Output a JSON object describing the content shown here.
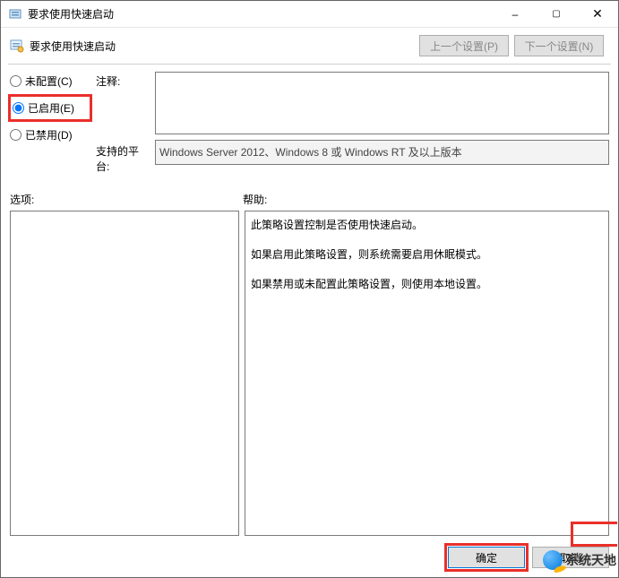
{
  "window": {
    "title": "要求使用快速启动"
  },
  "header": {
    "policy_title": "要求使用快速启动",
    "prev_label": "上一个设置(P)",
    "next_label": "下一个设置(N)"
  },
  "radios": {
    "not_configured": "未配置(C)",
    "enabled": "已启用(E)",
    "disabled": "已禁用(D)"
  },
  "labels": {
    "comment": "注释:",
    "platform": "支持的平台:",
    "options": "选项:",
    "help": "帮助:"
  },
  "fields": {
    "comment_value": "",
    "platform_value": "Windows Server 2012、Windows 8 或 Windows RT 及以上版本"
  },
  "help_text": {
    "p1": "此策略设置控制是否使用快速启动。",
    "p2": "如果启用此策略设置，则系统需要启用休眠模式。",
    "p3": "如果禁用或未配置此策略设置，则使用本地设置。"
  },
  "footer": {
    "ok": "确定",
    "cancel": "取消"
  },
  "watermark": {
    "text": "系统天地"
  }
}
